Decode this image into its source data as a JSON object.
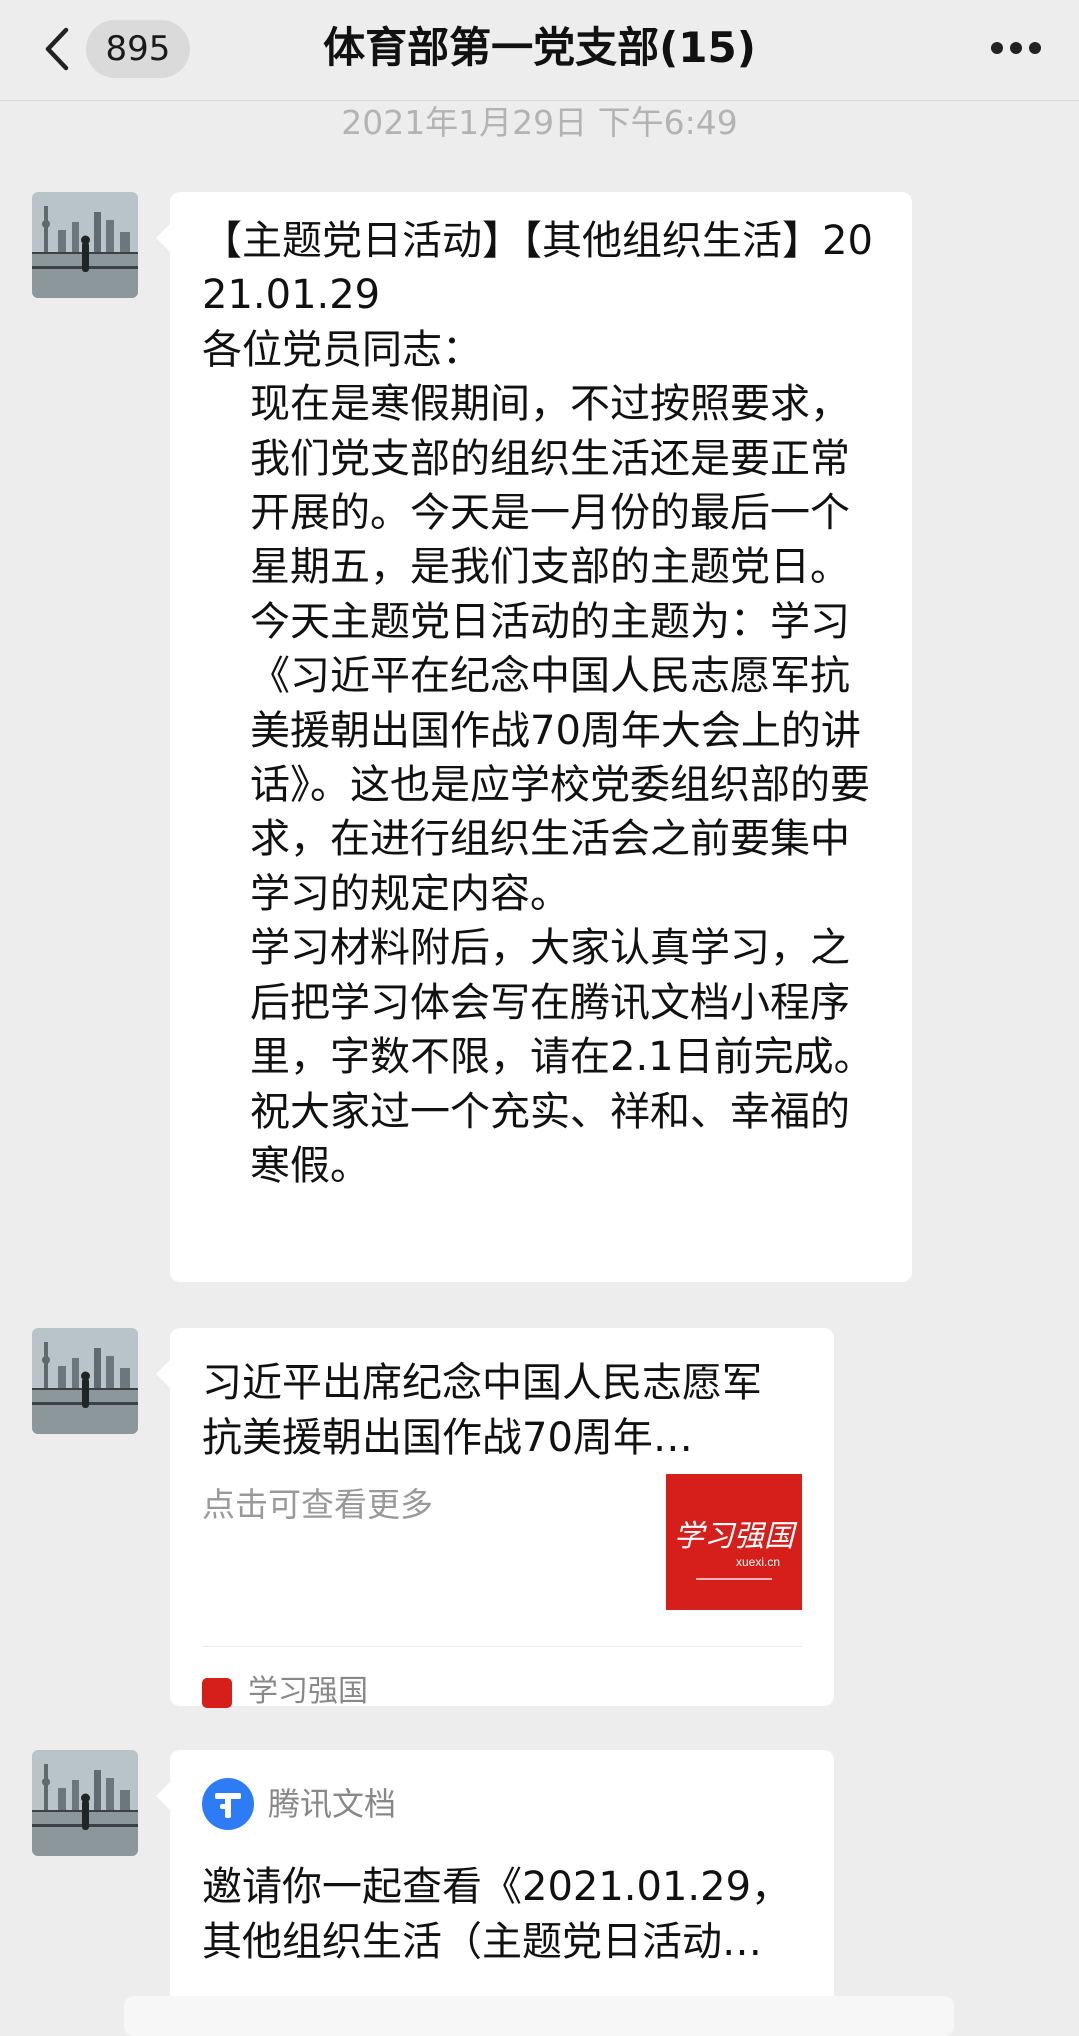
{
  "header": {
    "unread_count": "895",
    "title": "体育部第一党支部(15)"
  },
  "timestamp": "2021年1月29日 下午6:49",
  "messages": [
    {
      "type": "text",
      "paragraphs": [
        "【主题党日活动】【其他组织生活】2021.01.29",
        "各位党员同志：",
        "现在是寒假期间，不过按照要求，我们党支部的组织生活还是要正常开展的。今天是一月份的最后一个星期五，是我们支部的主题党日。今天主题党日活动的主题为：学习《习近平在纪念中国人民志愿军抗美援朝出国作战70周年大会上的讲话》。这也是应学校党委组织部的要求，在进行组织生活会之前要集中学习的规定内容。",
        "学习材料附后，大家认真学习，之后把学习体会写在腾讯文档小程序里，字数不限，请在2.1日前完成。",
        "祝大家过一个充实、祥和、幸福的寒假。"
      ]
    },
    {
      "type": "link-card",
      "title": "习近平出席纪念中国人民志愿军抗美援朝出国作战70周年…",
      "description": "点击可查看更多",
      "source": "学习强国",
      "thumb": {
        "logo_text": "学习强国",
        "domain": "xuexi.cn"
      }
    },
    {
      "type": "doc-card",
      "app_name": "腾讯文档",
      "title": "邀请你一起查看《2021.01.29，其他组织生活（主题党日活动…"
    }
  ],
  "colors": {
    "background": "#ededed",
    "bubble": "#ffffff",
    "xuexi_red": "#d61e1b",
    "tencent_docs_blue": "#2d7cf6"
  }
}
